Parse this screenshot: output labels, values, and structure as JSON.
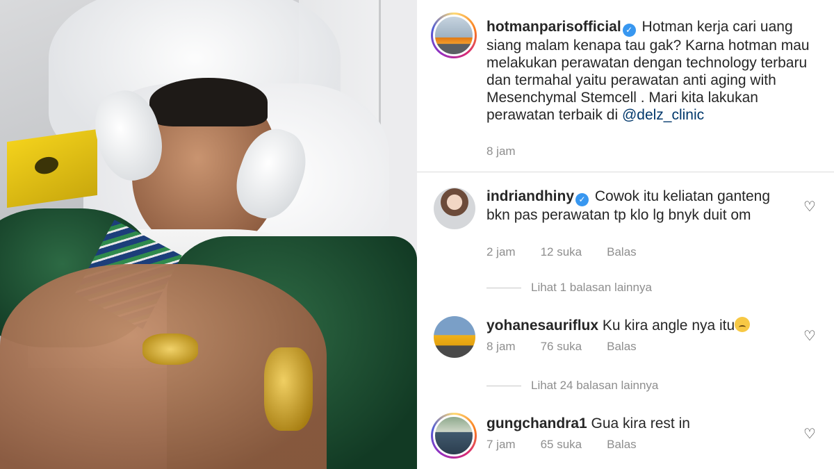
{
  "post": {
    "username": "hotmanparisofficial",
    "caption_text": "Hotman kerja cari uang siang malam kenapa tau gak? Karna hotman mau melakukan perawatan dengan technology terbaru dan termahal yaitu perawatan anti aging with Mesenchymal Stemcell . Mari kita lakukan perawatan terbaik di ",
    "caption_mention": "@delz_clinic",
    "time": "8 jam"
  },
  "comments": [
    {
      "username": "indriandhiny",
      "verified": true,
      "text": "Cowok itu keliatan ganteng bkn pas perawatan tp klo lg bnyk duit om",
      "time": "2 jam",
      "likes": "12 suka",
      "reply": "Balas",
      "more_replies": "Lihat 1 balasan lainnya"
    },
    {
      "username": "yohanesauriflux",
      "verified": false,
      "text": "Ku kira angle nya itu",
      "emoji": "crying-face-emoji",
      "time": "8 jam",
      "likes": "76 suka",
      "reply": "Balas",
      "more_replies": "Lihat 24 balasan lainnya"
    },
    {
      "username": "gungchandra1",
      "verified": false,
      "text": "Gua kira rest in",
      "time": "7 jam",
      "likes": "65 suka",
      "reply": "Balas"
    }
  ],
  "icons": {
    "verified": "verified-badge-icon",
    "like": "heart-icon"
  },
  "colors": {
    "verified_badge": "#3897f0",
    "mention": "#00376b",
    "meta_text": "#8e8e8e"
  }
}
